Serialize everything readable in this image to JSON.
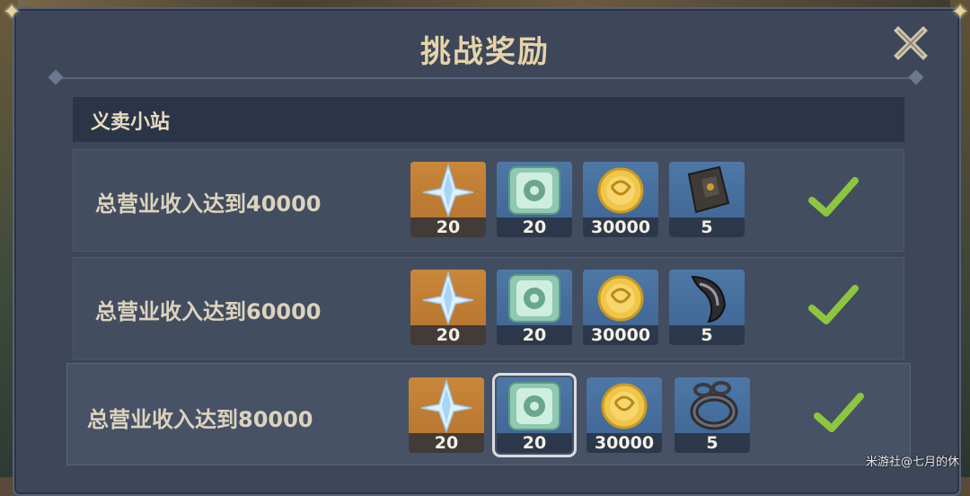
{
  "dialog": {
    "title": "挑战奖励",
    "section_title": "义卖小站"
  },
  "rows": [
    {
      "label": "总营业收入达到40000",
      "completed": true,
      "rewards": [
        {
          "icon": "primogem-icon",
          "count": "20"
        },
        {
          "icon": "fate-coin-icon",
          "count": "20"
        },
        {
          "icon": "mora-coin-icon",
          "count": "30000"
        },
        {
          "icon": "dark-relic-material-icon",
          "count": "5"
        }
      ]
    },
    {
      "label": "总营业收入达到60000",
      "completed": true,
      "rewards": [
        {
          "icon": "primogem-icon",
          "count": "20"
        },
        {
          "icon": "fate-coin-icon",
          "count": "20"
        },
        {
          "icon": "mora-coin-icon",
          "count": "30000"
        },
        {
          "icon": "horn-material-icon",
          "count": "5"
        }
      ]
    },
    {
      "label": "总营业收入达到80000",
      "completed": true,
      "rewards": [
        {
          "icon": "primogem-icon",
          "count": "20"
        },
        {
          "icon": "fate-coin-icon",
          "count": "20"
        },
        {
          "icon": "mora-coin-icon",
          "count": "30000"
        },
        {
          "icon": "chain-material-icon",
          "count": "5"
        }
      ]
    }
  ],
  "watermark": "米游社@七月的休",
  "colors": {
    "panel": "#3d4759",
    "gold_text": "#e6d3a8",
    "check_green": "#8cc63f",
    "five_star_bg": "#c8873a",
    "three_star_bg": "#4d78a6"
  }
}
